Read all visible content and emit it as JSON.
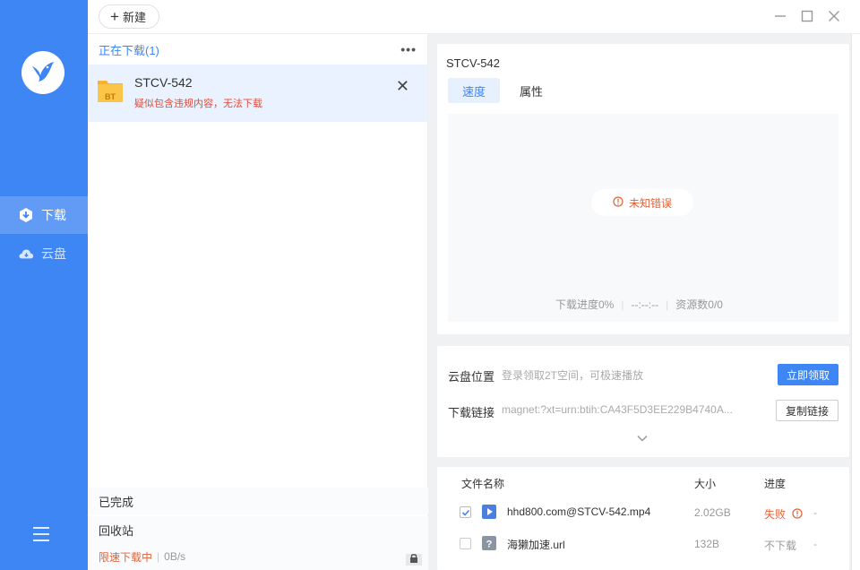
{
  "sidebar": {
    "nav": [
      {
        "label": "下载",
        "icon": "download-icon",
        "active": true
      },
      {
        "label": "云盘",
        "icon": "cloud-icon",
        "active": false
      }
    ]
  },
  "topbar": {
    "new_label": "新建"
  },
  "list": {
    "header": "正在下载(1)",
    "more": "•••",
    "task": {
      "name": "STCV-542",
      "error": "疑似包含违规内容，无法下载",
      "icon_text": "BT"
    },
    "completed": "已完成",
    "recycle": "回收站",
    "limit_label": "限速下载中",
    "speed": "0B/s"
  },
  "detail": {
    "title": "STCV-542",
    "tabs": [
      "速度",
      "属性"
    ],
    "error_text": "未知错误",
    "progress": "下载进度0%",
    "time": "--:--:--",
    "sources": "资源数0/0"
  },
  "cloud": {
    "location_label": "云盘位置",
    "location_text": "登录领取2T空间，可极速播放",
    "claim_button": "立即领取",
    "link_label": "下载链接",
    "link_value": "magnet:?xt=urn:btih:CA43F5D3EE229B4740A...",
    "copy_button": "复制链接"
  },
  "files": {
    "headers": {
      "name": "文件名称",
      "size": "大小",
      "progress": "进度"
    },
    "rows": [
      {
        "name": "hhd800.com@STCV-542.mp4",
        "size": "2.02GB",
        "progress": "失败",
        "dash": "-",
        "checked": true
      },
      {
        "name": "海獭加速.url",
        "size": "132B",
        "progress": "不下载",
        "dash": "-",
        "checked": false
      }
    ]
  },
  "colors": {
    "accent": "#3f86f5",
    "error": "#e3623a"
  }
}
